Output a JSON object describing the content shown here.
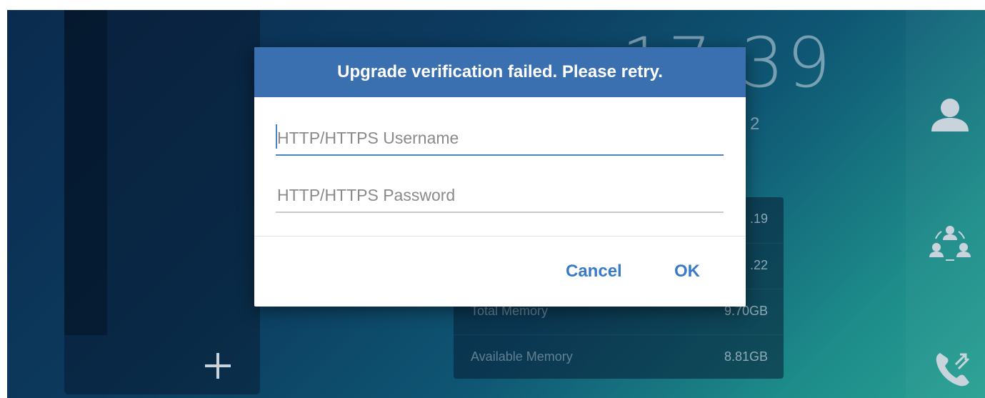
{
  "clock": {
    "time": "17:39",
    "date": "2"
  },
  "info_card": {
    "rows": [
      {
        "label": "",
        "value": ".19"
      },
      {
        "label": "",
        "value": ".22"
      },
      {
        "label": "Total Memory",
        "value": "9.70GB"
      },
      {
        "label": "Available Memory",
        "value": "8.81GB"
      }
    ]
  },
  "dialog": {
    "title": "Upgrade verification failed. Please retry.",
    "username": {
      "value": "",
      "placeholder": "HTTP/HTTPS Username"
    },
    "password": {
      "value": "",
      "placeholder": "HTTP/HTTPS Password"
    },
    "cancel_label": "Cancel",
    "ok_label": "OK"
  },
  "side_icons": [
    "contacts-icon",
    "conference-icon",
    "call-forward-icon"
  ],
  "left_panel": {
    "add_icon": "plus-icon"
  },
  "colors": {
    "dialog_header": "#3a6fb0",
    "button_text": "#3a7bc8",
    "focus_underline": "#4a83c6"
  }
}
